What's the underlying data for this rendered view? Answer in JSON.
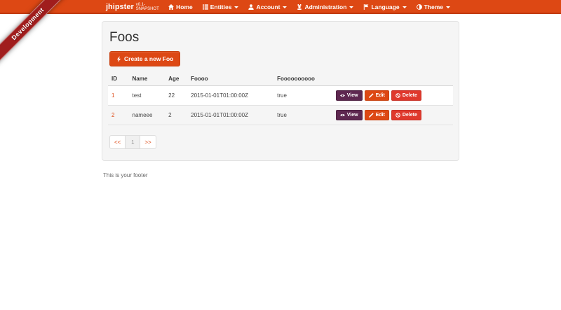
{
  "ribbon": {
    "label": "Development"
  },
  "navbar": {
    "brand": "jhipster",
    "version": "v0.1-SNAPSHOT",
    "items": [
      {
        "label": "Home"
      },
      {
        "label": "Entities"
      },
      {
        "label": "Account"
      },
      {
        "label": "Administration"
      },
      {
        "label": "Language"
      },
      {
        "label": "Theme"
      }
    ]
  },
  "main": {
    "title": "Foos",
    "create_button_label": "Create a new Foo",
    "table": {
      "headers": [
        "ID",
        "Name",
        "Age",
        "Foooo",
        "Foooooooooo"
      ],
      "rows": [
        {
          "id": "1",
          "name": "test",
          "age": "22",
          "datetime": "2015-01-01T01:00:00Z",
          "bool": "true"
        },
        {
          "id": "2",
          "name": "nameee",
          "age": "2",
          "datetime": "2015-01-01T01:00:00Z",
          "bool": "true"
        }
      ],
      "actions": {
        "view": "View",
        "edit": "Edit",
        "delete": "Delete"
      }
    },
    "pagination": {
      "first": "<<",
      "current_page": "1",
      "last": ">>"
    }
  },
  "footer": {
    "text": "This is your footer"
  },
  "colors": {
    "navbar_bg": "#DD4814",
    "navbar_border": "#C13A10",
    "ribbon_bg": "#A01D1D",
    "accent": "#DD4814",
    "view_button_bg": "#5E2750",
    "edit_button_bg": "#DD4814",
    "delete_button_bg": "#DF382C",
    "panel_bg": "#F5F5F5"
  }
}
